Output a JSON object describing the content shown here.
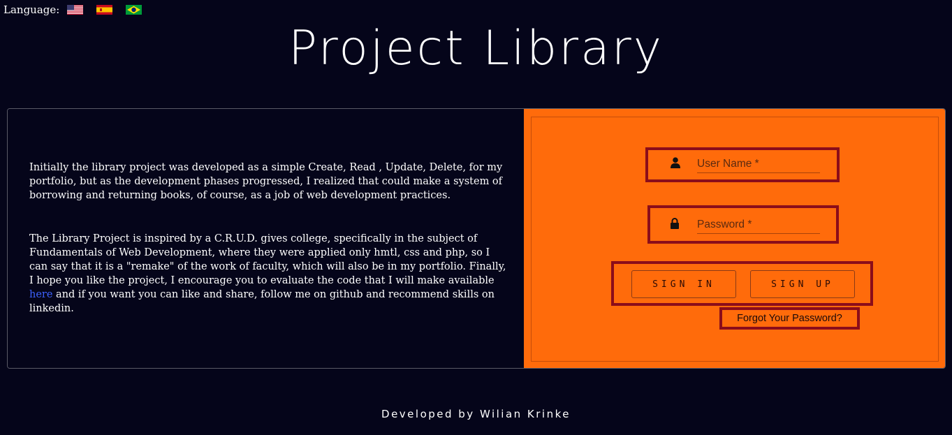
{
  "language": {
    "label": "Language:",
    "flags": [
      {
        "icon": "us-flag-icon"
      },
      {
        "icon": "spain-flag-icon"
      },
      {
        "icon": "brazil-flag-icon"
      }
    ]
  },
  "header": {
    "title": "Project Library"
  },
  "about": {
    "paragraph_1": "Initially the library project was developed as a simple Create, Read , Update, Delete, for my portfolio, but as the development phases progressed, I realized that could make a system of borrowing and returning books, of course, as a job of web development practices.",
    "paragraph_2_before_link": "The Library Project is inspired by a C.R.U.D. gives college, specifically in the subject of Fundamentals of Web Development, where they were applied only hmtl, css and php, so I can say that it is a \"remake\" of the work of faculty, which will also be in my portfolio. Finally, I hope you like the project, I encourage you to evaluate the code that I will make available",
    "link_text": "here",
    "paragraph_2_after_link": " and if you want you can like and share, follow me on github and recommend skills on linkedin."
  },
  "login": {
    "username": {
      "value": "",
      "placeholder": "User Name *",
      "icon": "user-icon"
    },
    "password": {
      "value": "",
      "placeholder": "Password *",
      "icon": "lock-icon"
    },
    "sign_in_label": "SIGN IN",
    "sign_up_label": "SIGN UP",
    "forgot_label": "Forgot Your Password?"
  },
  "footer": {
    "text": "Developed by Wilian Krinke"
  },
  "colors": {
    "background": "#05051a",
    "login_panel": "#ff6b0b",
    "highlight_border": "#8b0d1a",
    "link": "#3d62ff"
  }
}
